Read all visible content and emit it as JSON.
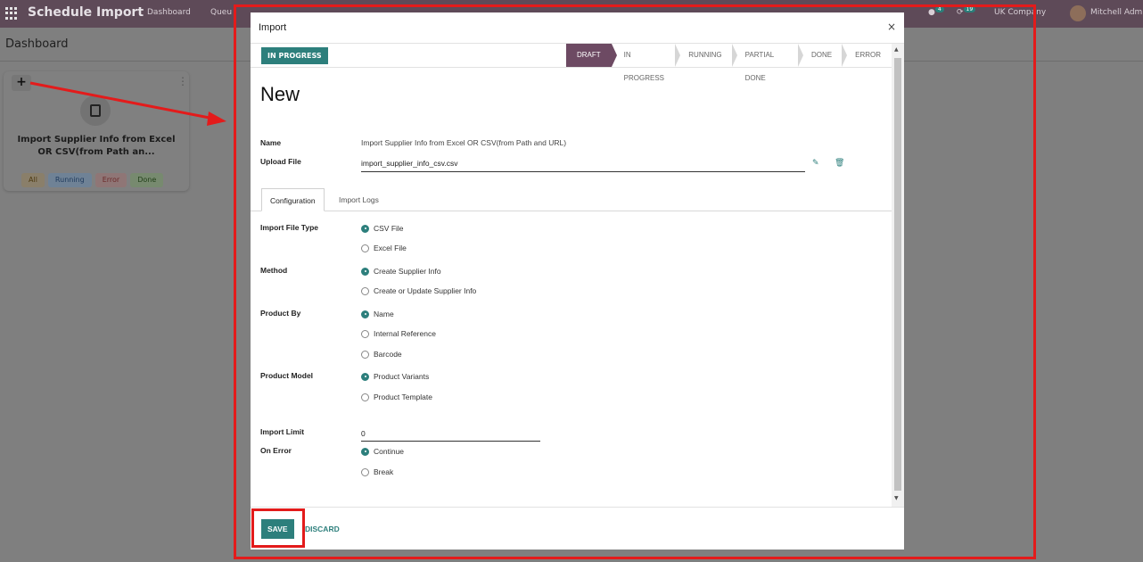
{
  "navbar": {
    "brand": "Schedule Import",
    "links": [
      "Dashboard",
      "Queu"
    ],
    "chat_badge": "4",
    "activity_badge": "19",
    "company": "UK Company",
    "user": "Mitchell Adm"
  },
  "control": {
    "title": "Dashboard"
  },
  "card": {
    "name": "Import Supplier Info from Excel OR CSV(from Path an...",
    "pills": [
      "All",
      "Running",
      "Error",
      "Done"
    ]
  },
  "modal": {
    "title": "Import",
    "close": "×",
    "status_button": "IN PROGRESS",
    "stages": [
      "DRAFT",
      "IN PROGRESS",
      "RUNNING",
      "PARTIAL DONE",
      "DONE",
      "ERROR"
    ],
    "active_stage": "DRAFT",
    "record_title": "New",
    "name_label": "Name",
    "name_value": "Import Supplier Info from Excel OR CSV(from Path and URL)",
    "upload_label": "Upload File",
    "upload_value": "import_supplier_info_csv.csv",
    "tabs": [
      "Configuration",
      "Import Logs"
    ],
    "fields": {
      "file_type": {
        "label": "Import File Type",
        "options": [
          "CSV File",
          "Excel File"
        ],
        "selected": "CSV File"
      },
      "method": {
        "label": "Method",
        "options": [
          "Create Supplier Info",
          "Create or Update Supplier Info"
        ],
        "selected": "Create Supplier Info"
      },
      "product_by": {
        "label": "Product By",
        "options": [
          "Name",
          "Internal Reference",
          "Barcode"
        ],
        "selected": "Name"
      },
      "product_model": {
        "label": "Product Model",
        "options": [
          "Product Variants",
          "Product Template"
        ],
        "selected": "Product Variants"
      },
      "import_limit": {
        "label": "Import Limit",
        "value": "0"
      },
      "on_error": {
        "label": "On Error",
        "options": [
          "Continue",
          "Break"
        ],
        "selected": "Continue"
      }
    },
    "save_label": "SAVE",
    "discard_label": "DISCARD"
  },
  "colors": {
    "primary": "#2d7f7c",
    "active_stage": "#6d4a63",
    "annotation": "#e31b1b",
    "navbar": "#5e4a58"
  }
}
